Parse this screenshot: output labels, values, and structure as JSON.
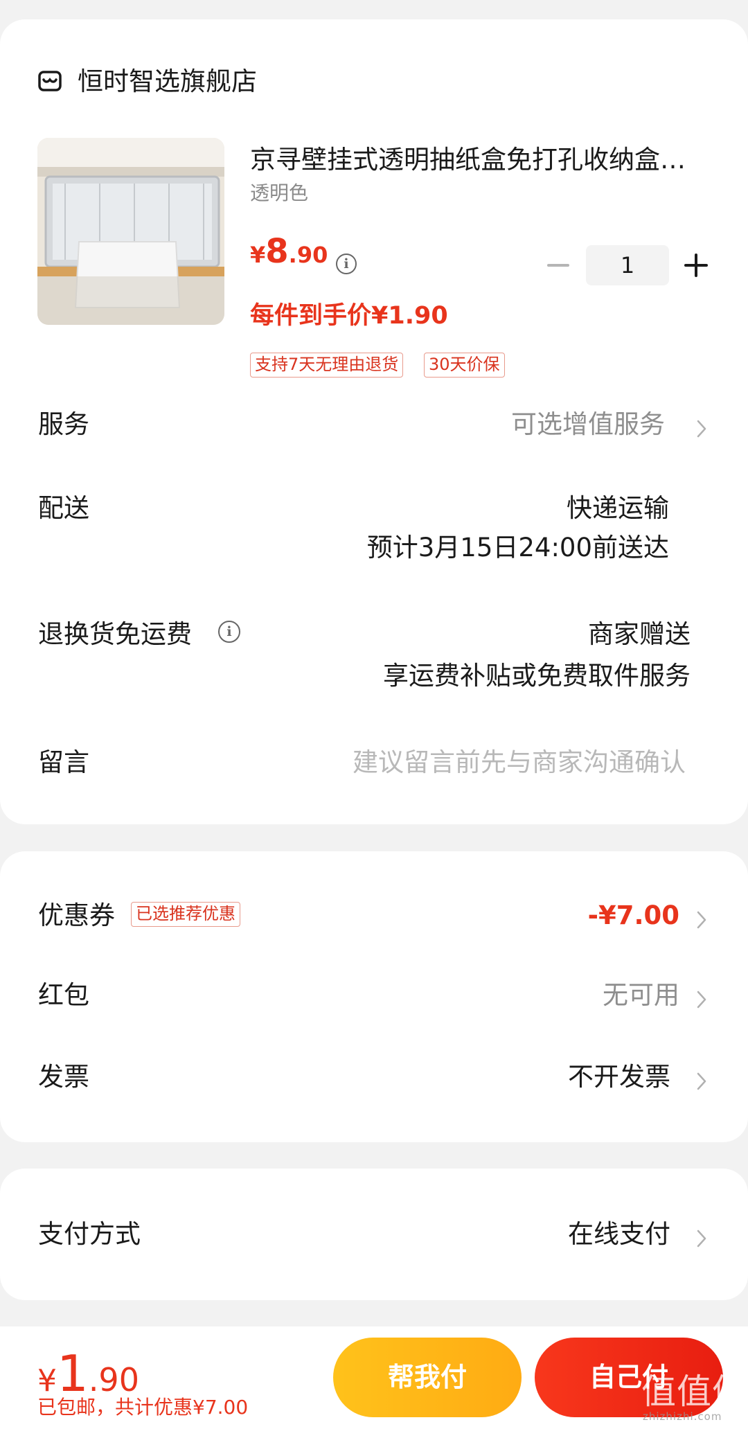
{
  "store": {
    "name": "恒时智选旗舰店",
    "icon": "store-icon"
  },
  "product": {
    "title": "京寻壁挂式透明抽纸盒免打孔收纳盒…",
    "variant": "透明色",
    "price": {
      "currency": "¥",
      "integer": "8",
      "decimal": ".90"
    },
    "final_price": "每件到手价¥1.90",
    "tags": [
      "支持7天无理由退货",
      "30天价保"
    ],
    "quantity": "1"
  },
  "rows": {
    "service": {
      "label": "服务",
      "value": "可选增值服务"
    },
    "delivery": {
      "label": "配送",
      "value_line1": "快递运输",
      "value_line2": "预计3月15日24:00前送达"
    },
    "return_shipping": {
      "label": "退换货免运费",
      "value_line1": "商家赠送",
      "value_line2": "享运费补贴或免费取件服务"
    },
    "message": {
      "label": "留言",
      "placeholder": "建议留言前先与商家沟通确认"
    },
    "coupon": {
      "label": "优惠券",
      "badge": "已选推荐优惠",
      "value": "-¥7.00"
    },
    "red_packet": {
      "label": "红包",
      "value": "无可用"
    },
    "invoice": {
      "label": "发票",
      "value": "不开发票"
    },
    "payment_method": {
      "label": "支付方式",
      "value": "在线支付"
    }
  },
  "bottom": {
    "total": {
      "currency": "¥",
      "integer": "1",
      "decimal": ".90"
    },
    "sub": "已包邮，共计优惠¥7.00",
    "help_pay_label": "帮我付",
    "self_pay_label": "自己付"
  },
  "watermark": {
    "main": "值值值",
    "sub": "zhizhizhi.com"
  },
  "colors": {
    "accent_red": "#e8341c",
    "help_pay_yellow": "#ffb814",
    "self_pay_red": "#f02a16"
  }
}
